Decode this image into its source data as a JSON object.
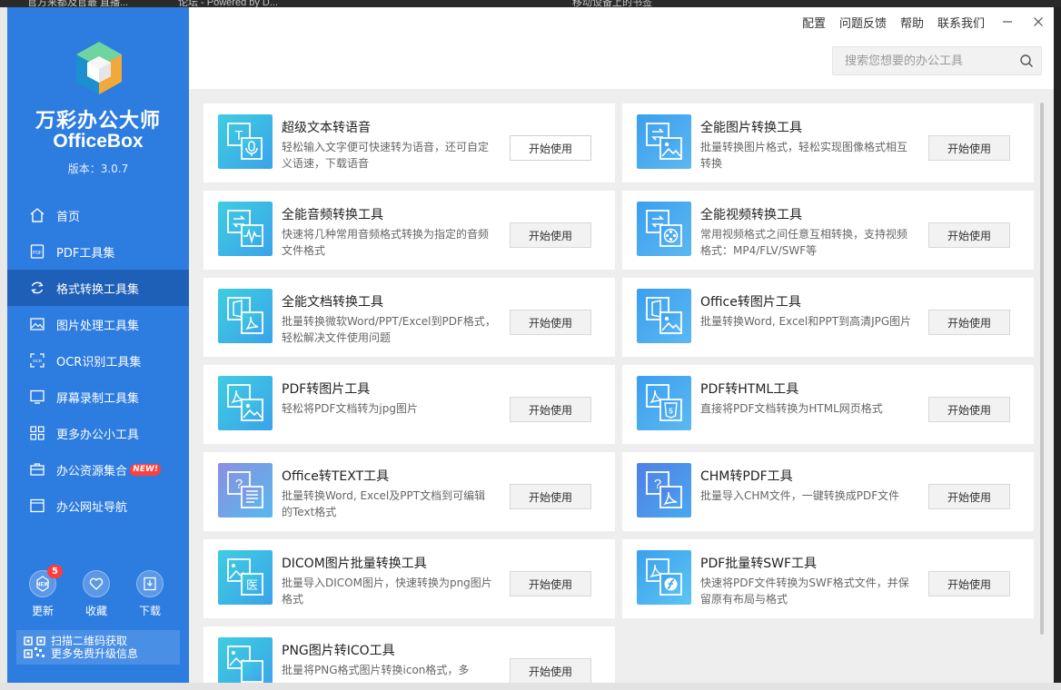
{
  "background": {
    "taskbar_fragments": [
      "官方来都及官最 直播...",
      "论坛 - Powered by D...",
      "移动设备上的书签"
    ]
  },
  "sidebar": {
    "app_name": "万彩办公大师",
    "app_name_en": "OfficeBox",
    "version": "版本：3.0.7",
    "nav": [
      {
        "label": "首页",
        "icon": "home-icon"
      },
      {
        "label": "PDF工具集",
        "icon": "pdf-icon"
      },
      {
        "label": "格式转换工具集",
        "icon": "convert-icon",
        "active": true
      },
      {
        "label": "图片处理工具集",
        "icon": "image-icon"
      },
      {
        "label": "OCR识别工具集",
        "icon": "ocr-icon"
      },
      {
        "label": "屏幕录制工具集",
        "icon": "monitor-icon"
      },
      {
        "label": "更多办公小工具",
        "icon": "apps-icon"
      },
      {
        "label": "办公资源集合",
        "icon": "briefcase-icon",
        "badge": "NEW!"
      },
      {
        "label": "办公网址导航",
        "icon": "browser-icon"
      }
    ],
    "actions": {
      "update_label": "更新",
      "update_count": "5",
      "favorite_label": "收藏",
      "download_label": "下载"
    },
    "qr": {
      "line1": "扫描二维码获取",
      "line2": "更多免费升级信息"
    }
  },
  "header": {
    "links": [
      "配置",
      "问题反馈",
      "帮助",
      "联系我们"
    ],
    "search_placeholder": "搜索您想要的办公工具"
  },
  "tools": [
    {
      "title": "超级文本转语音",
      "desc": "轻松输入文字便可快速转为语音，还可自定义语速，下载语音",
      "button": "开始使用",
      "icon": "text-to-speech-icon"
    },
    {
      "title": "全能图片转换工具",
      "desc": "批量转换图片格式，轻松实现图像格式相互转换",
      "button": "开始使用",
      "icon": "image-convert-icon"
    },
    {
      "title": "全能音频转换工具",
      "desc": "快速将几种常用音频格式转换为指定的音频文件格式",
      "button": "开始使用",
      "icon": "audio-convert-icon"
    },
    {
      "title": "全能视频转换工具",
      "desc": "常用视频格式之间任意互相转换，支持视频格式：MP4/FLV/SWF等",
      "button": "开始使用",
      "icon": "video-convert-icon"
    },
    {
      "title": "全能文档转换工具",
      "desc": "批量转换微软Word/PPT/Excel到PDF格式，轻松解决文件使用问题",
      "button": "开始使用",
      "icon": "document-convert-icon"
    },
    {
      "title": "Office转图片工具",
      "desc": "批量转换Word, Excel和PPT到高清JPG图片",
      "button": "开始使用",
      "icon": "office-to-image-icon"
    },
    {
      "title": "PDF转图片工具",
      "desc": "轻松将PDF文档转为jpg图片",
      "button": "开始使用",
      "icon": "pdf-to-image-icon"
    },
    {
      "title": "PDF转HTML工具",
      "desc": "直接将PDF文档转换为HTML网页格式",
      "button": "开始使用",
      "icon": "pdf-to-html-icon"
    },
    {
      "title": "Office转TEXT工具",
      "desc": "批量转换Word, Excel及PPT文档到可编辑的Text格式",
      "button": "开始使用",
      "icon": "office-to-text-icon"
    },
    {
      "title": "CHM转PDF工具",
      "desc": "批量导入CHM文件，一键转换成PDF文件",
      "button": "开始使用",
      "icon": "chm-to-pdf-icon"
    },
    {
      "title": "DICOM图片批量转换工具",
      "desc": "批量导入DICOM图片，快速转换为png图片格式",
      "button": "开始使用",
      "icon": "dicom-convert-icon"
    },
    {
      "title": "PDF批量转SWF工具",
      "desc": "快速将PDF文件转换为SWF格式文件，并保留原有布局与格式",
      "button": "开始使用",
      "icon": "pdf-to-swf-icon"
    },
    {
      "title": "PNG图片转ICO工具",
      "desc": "批量将PNG格式图片转换icon格式，多",
      "button": "开始使用",
      "icon": "png-to-ico-icon"
    }
  ],
  "colors": {
    "sidebar": "#2d7ce0",
    "sidebar_active": "#1e5fb8",
    "content_bg": "#eeeeee",
    "badge_red": "#ff3c3c"
  }
}
